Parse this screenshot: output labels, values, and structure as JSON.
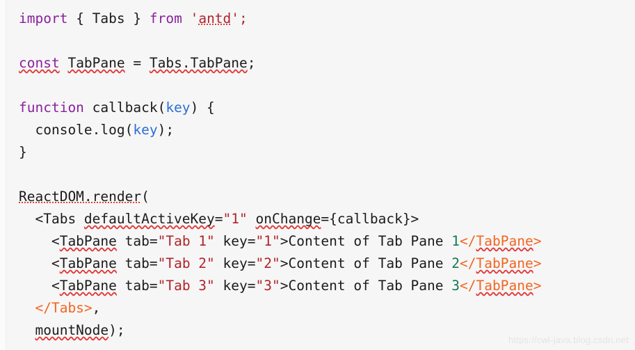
{
  "editor": {
    "background_color": "#f6f6f6",
    "default_text_color": "#1b1b1b",
    "font_size_px": 19.5,
    "line_height_px": 32,
    "colors": {
      "keyword": "#8a1f9e",
      "string": "#b0232a",
      "parameter": "#2a6fd6",
      "number": "#117a52",
      "closing_tag": "#f26522",
      "spellcheck_underline": "#e03a3a"
    }
  },
  "code": {
    "language": "jsx",
    "lines": [
      {
        "n": 1,
        "text": "import { Tabs } from 'antd';",
        "tokens": [
          {
            "t": "import",
            "c": "kw"
          },
          {
            "t": " { Tabs } ",
            "c": "plain"
          },
          {
            "t": "from",
            "c": "kw"
          },
          {
            "t": " ",
            "c": "plain"
          },
          {
            "t": "'",
            "c": "str"
          },
          {
            "t": "antd",
            "c": "str dot"
          },
          {
            "t": "';",
            "c": "str"
          }
        ]
      },
      {
        "n": 2,
        "text": "",
        "tokens": []
      },
      {
        "n": 3,
        "text": "const TabPane = Tabs.TabPane;",
        "tokens": [
          {
            "t": "const",
            "c": "kw sq"
          },
          {
            "t": " ",
            "c": "plain"
          },
          {
            "t": "TabPane",
            "c": "plain sq"
          },
          {
            "t": " = ",
            "c": "plain"
          },
          {
            "t": "Tabs.TabPane",
            "c": "plain sq"
          },
          {
            "t": ";",
            "c": "plain"
          }
        ]
      },
      {
        "n": 4,
        "text": "",
        "tokens": []
      },
      {
        "n": 5,
        "text": "function callback(key) {",
        "tokens": [
          {
            "t": "function",
            "c": "kw"
          },
          {
            "t": " callback(",
            "c": "plain"
          },
          {
            "t": "key",
            "c": "param"
          },
          {
            "t": ") {",
            "c": "plain"
          }
        ]
      },
      {
        "n": 6,
        "text": "  console.log(key);",
        "tokens": [
          {
            "t": "  console.log(",
            "c": "plain"
          },
          {
            "t": "key",
            "c": "param"
          },
          {
            "t": ");",
            "c": "plain"
          }
        ]
      },
      {
        "n": 7,
        "text": "}",
        "tokens": [
          {
            "t": "}",
            "c": "plain"
          }
        ]
      },
      {
        "n": 8,
        "text": "",
        "tokens": []
      },
      {
        "n": 9,
        "text": "ReactDOM.render(",
        "tokens": [
          {
            "t": "ReactDOM.render",
            "c": "plain dot"
          },
          {
            "t": "(",
            "c": "plain"
          }
        ]
      },
      {
        "n": 10,
        "text": "  <Tabs defaultActiveKey=\"1\" onChange={callback}>",
        "tokens": [
          {
            "t": "  <Tabs ",
            "c": "plain"
          },
          {
            "t": "defaultActiveKey",
            "c": "plain sq"
          },
          {
            "t": "=",
            "c": "plain"
          },
          {
            "t": "\"1\"",
            "c": "str"
          },
          {
            "t": " ",
            "c": "plain"
          },
          {
            "t": "onChange",
            "c": "plain sq"
          },
          {
            "t": "={callback}>",
            "c": "plain"
          }
        ]
      },
      {
        "n": 11,
        "text": "    <TabPane tab=\"Tab 1\" key=\"1\">Content of Tab Pane 1</TabPane>",
        "tokens": [
          {
            "t": "    <",
            "c": "plain"
          },
          {
            "t": "TabPane",
            "c": "plain sq"
          },
          {
            "t": " tab=",
            "c": "plain"
          },
          {
            "t": "\"Tab 1\"",
            "c": "str"
          },
          {
            "t": " key=",
            "c": "plain"
          },
          {
            "t": "\"1\"",
            "c": "str"
          },
          {
            "t": ">Content of Tab Pane ",
            "c": "plain"
          },
          {
            "t": "1",
            "c": "num"
          },
          {
            "t": "</",
            "c": "tagcls"
          },
          {
            "t": "TabPane",
            "c": "tagcls sq"
          },
          {
            "t": ">",
            "c": "tagcls"
          }
        ]
      },
      {
        "n": 12,
        "text": "    <TabPane tab=\"Tab 2\" key=\"2\">Content of Tab Pane 2</TabPane>",
        "tokens": [
          {
            "t": "    <",
            "c": "plain"
          },
          {
            "t": "TabPane",
            "c": "plain sq"
          },
          {
            "t": " tab=",
            "c": "plain"
          },
          {
            "t": "\"Tab 2\"",
            "c": "str"
          },
          {
            "t": " key=",
            "c": "plain"
          },
          {
            "t": "\"2\"",
            "c": "str"
          },
          {
            "t": ">Content of Tab Pane ",
            "c": "plain"
          },
          {
            "t": "2",
            "c": "num"
          },
          {
            "t": "</",
            "c": "tagcls"
          },
          {
            "t": "TabPane",
            "c": "tagcls sq"
          },
          {
            "t": ">",
            "c": "tagcls"
          }
        ]
      },
      {
        "n": 13,
        "text": "    <TabPane tab=\"Tab 3\" key=\"3\">Content of Tab Pane 3</TabPane>",
        "tokens": [
          {
            "t": "    <",
            "c": "plain"
          },
          {
            "t": "TabPane",
            "c": "plain sq"
          },
          {
            "t": " tab=",
            "c": "plain"
          },
          {
            "t": "\"Tab 3\"",
            "c": "str"
          },
          {
            "t": " key=",
            "c": "plain"
          },
          {
            "t": "\"3\"",
            "c": "str"
          },
          {
            "t": ">Content of Tab Pane ",
            "c": "plain"
          },
          {
            "t": "3",
            "c": "num"
          },
          {
            "t": "</",
            "c": "tagcls"
          },
          {
            "t": "TabPane",
            "c": "tagcls sq"
          },
          {
            "t": ">",
            "c": "tagcls"
          }
        ]
      },
      {
        "n": 14,
        "text": "  </Tabs>,",
        "tokens": [
          {
            "t": "  ",
            "c": "plain"
          },
          {
            "t": "</Tabs>",
            "c": "tagcls"
          },
          {
            "t": ",",
            "c": "plain"
          }
        ]
      },
      {
        "n": 15,
        "text": "  mountNode);",
        "tokens": [
          {
            "t": "  ",
            "c": "plain"
          },
          {
            "t": "mountNode",
            "c": "plain sq"
          },
          {
            "t": ");",
            "c": "plain"
          }
        ]
      }
    ]
  },
  "watermark": {
    "text": "https://cwl-java.blog.csdn.net"
  }
}
